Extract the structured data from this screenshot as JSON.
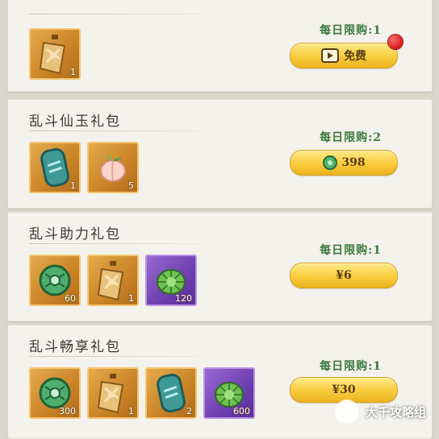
{
  "packs": [
    {
      "title": "",
      "limit": "每日限购:1",
      "button": {
        "label": "免费",
        "has_video_icon": true,
        "has_red_dot": true
      },
      "items": [
        {
          "icon": "golden-talisman-icon",
          "frame": "gold",
          "qty": "1"
        }
      ]
    },
    {
      "title": "乱斗仙玉礼包",
      "limit": "每日限购:2",
      "button": {
        "label": "398",
        "currency_icon": "jade-coin-icon"
      },
      "items": [
        {
          "icon": "teal-jade-tablet-icon",
          "frame": "gold",
          "qty": "1"
        },
        {
          "icon": "peach-icon",
          "frame": "gold",
          "qty": "5"
        }
      ]
    },
    {
      "title": "乱斗助力礼包",
      "limit": "每日限购:1",
      "button": {
        "label": "¥6"
      },
      "items": [
        {
          "icon": "jade-coin-icon",
          "frame": "gold",
          "qty": "60"
        },
        {
          "icon": "golden-talisman-icon",
          "frame": "gold",
          "qty": "1"
        },
        {
          "icon": "green-turtle-shell-icon",
          "frame": "purple",
          "qty": "120"
        }
      ]
    },
    {
      "title": "乱斗畅享礼包",
      "limit": "每日限购:1",
      "button": {
        "label": "¥30"
      },
      "items": [
        {
          "icon": "jade-coin-icon",
          "frame": "gold",
          "qty": "300"
        },
        {
          "icon": "golden-talisman-icon",
          "frame": "gold",
          "qty": "1"
        },
        {
          "icon": "teal-jade-tablet-icon",
          "frame": "gold",
          "qty": "2"
        },
        {
          "icon": "green-turtle-shell-icon",
          "frame": "purple",
          "qty": "600"
        }
      ]
    }
  ],
  "watermark": {
    "text": "大千攻略组"
  }
}
